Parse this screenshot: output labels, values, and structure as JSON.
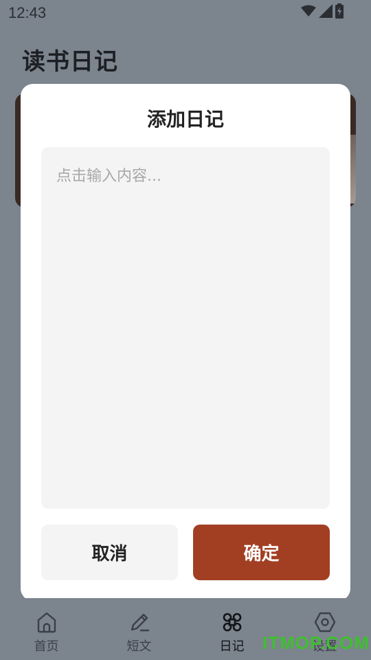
{
  "status_bar": {
    "time": "12:43"
  },
  "page": {
    "title": "读书日记"
  },
  "dialog": {
    "title": "添加日记",
    "input_placeholder": "点击输入内容...",
    "input_value": "",
    "cancel_label": "取消",
    "confirm_label": "确定"
  },
  "bottom_nav": {
    "items": [
      {
        "label": "首页",
        "icon": "home-icon"
      },
      {
        "label": "短文",
        "icon": "pencil-icon"
      },
      {
        "label": "日记",
        "icon": "command-icon"
      },
      {
        "label": "设置",
        "icon": "settings-icon"
      }
    ],
    "active_index": 2
  },
  "watermark": "ITMOP.COM",
  "colors": {
    "accent": "#a23f23",
    "overlay": "#7c848e",
    "dialog_bg": "#ffffff",
    "input_bg": "#f4f4f4"
  }
}
